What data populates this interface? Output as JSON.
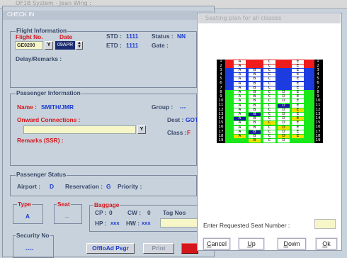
{
  "window_title": "OF1B System - Jean Wing :",
  "checkin": {
    "header": "CHECK IN",
    "flight_info": {
      "group_title": "Flight Information",
      "flight_no_label": "Flight No.",
      "date_label": "Date",
      "flight_no_value": "GE0200",
      "flight_dropdown": "Y",
      "date_value": "09APR",
      "std_label": "STD :",
      "std_value": "1111",
      "status_label": "Status :",
      "status_value": "NN",
      "etd_label": "ETD :",
      "etd_value": "1111",
      "gate_label": "Gate :",
      "delay_label": "Delay/Remarks :"
    },
    "passenger_info": {
      "group_title": "Passenger Information",
      "name_label": "Name :",
      "name_value": "SMITH/JMR",
      "group_label": "Group :",
      "group_value": "---",
      "onward_label": "Onward Connections :",
      "onward_dropdown": "Y",
      "dest_label": "Dest :",
      "dest_value": "GOT",
      "class_label": "Class :",
      "class_value": "F",
      "remarks_label": "Remarks (SSR) :"
    },
    "passenger_status": {
      "group_title": "Passenger Status",
      "airport_label": "Airport :",
      "airport_value": "D",
      "reservation_label": "Reservation :",
      "reservation_value": "G",
      "priority_label": "Priority :"
    },
    "type": {
      "group_title": "Type",
      "value": "A"
    },
    "seat": {
      "group_title": "Seat",
      "value": "_"
    },
    "baggage": {
      "group_title": "Baggage",
      "cp_label": "CP :",
      "cp_value": "0",
      "cw_label": "CW :",
      "cw_value": "0",
      "tag_label": "Tag Nos",
      "hp_label": "HP :",
      "hp_value": "xxx",
      "hw_label": "HW :",
      "hw_value": "xxx"
    },
    "security": {
      "group_title": "Security No",
      "value": "----"
    },
    "buttons": {
      "offload": "OffloAd Psgr",
      "print": "Print"
    }
  },
  "seating": {
    "title": "Seating plan for all classes",
    "request_label": "Enter Requested Seat Number :",
    "request_value": "",
    "buttons": {
      "cancel": {
        "first": "C",
        "rest": "ancel"
      },
      "up": {
        "first": "U",
        "rest": "p"
      },
      "down": {
        "first": "D",
        "rest": "own"
      },
      "ok": {
        "first": "O",
        "rest": "k"
      }
    },
    "colors": {
      "first": "#ee1c1c",
      "business": "#1c3ce0",
      "economy": "#1ae81a",
      "occupied": "#1a1aa0",
      "reserved": "#f0e000",
      "row_number": "#000000"
    },
    "rows": [
      {
        "number": "1",
        "zone": "first",
        "seats": [
          {
            "l": "A",
            "s": "free"
          },
          {
            "l": "C",
            "s": "free"
          },
          {
            "l": "E",
            "s": "free"
          }
        ]
      },
      {
        "number": "2",
        "zone": "first",
        "seats": [
          {
            "l": "A",
            "s": "free"
          },
          {
            "l": "C",
            "s": "free"
          },
          {
            "l": "E",
            "s": "free"
          }
        ]
      },
      {
        "number": "3",
        "zone": "business",
        "seats": [
          {
            "l": "A",
            "s": "free"
          },
          {
            "l": "B",
            "s": "free"
          },
          {
            "l": "C",
            "s": "free"
          },
          {
            "l": "E",
            "s": "free"
          }
        ]
      },
      {
        "number": "4",
        "zone": "business",
        "seats": [
          {
            "l": "A",
            "s": "free"
          },
          {
            "l": "B",
            "s": "free"
          },
          {
            "l": "C",
            "s": "free"
          },
          {
            "l": "E",
            "s": "free"
          }
        ]
      },
      {
        "number": "5",
        "zone": "business",
        "seats": [
          {
            "l": "A",
            "s": "free"
          },
          {
            "l": "B",
            "s": "free"
          },
          {
            "l": "C",
            "s": "free"
          },
          {
            "l": "E",
            "s": "free"
          }
        ]
      },
      {
        "number": "6",
        "zone": "business",
        "seats": [
          {
            "l": "A",
            "s": "free"
          },
          {
            "l": "B",
            "s": "free"
          },
          {
            "l": "C",
            "s": "free"
          },
          {
            "l": "E",
            "s": "free"
          }
        ]
      },
      {
        "number": "7",
        "zone": "business",
        "seats": [
          {
            "l": "A",
            "s": "free"
          },
          {
            "l": "B",
            "s": "free"
          },
          {
            "l": "C",
            "s": "free"
          },
          {
            "l": "E",
            "s": "free"
          }
        ]
      },
      {
        "number": "8",
        "zone": "economy",
        "seats": [
          {
            "l": "A",
            "s": "free"
          },
          {
            "l": "B",
            "s": "free"
          },
          {
            "l": "C",
            "s": "free"
          },
          {
            "l": "D",
            "s": "free"
          },
          {
            "l": "E",
            "s": "free"
          }
        ]
      },
      {
        "number": "9",
        "zone": "economy",
        "seats": [
          {
            "l": "A",
            "s": "free"
          },
          {
            "l": "B",
            "s": "free"
          },
          {
            "l": "C",
            "s": "free"
          },
          {
            "l": "D",
            "s": "free"
          },
          {
            "l": "E",
            "s": "free"
          }
        ]
      },
      {
        "number": "10",
        "zone": "economy",
        "seats": [
          {
            "l": "A",
            "s": "free"
          },
          {
            "l": "B",
            "s": "free"
          },
          {
            "l": "C",
            "s": "free"
          },
          {
            "l": "D",
            "s": "free"
          },
          {
            "l": "E",
            "s": "free"
          }
        ]
      },
      {
        "number": "11",
        "zone": "economy",
        "seats": [
          {
            "l": "A",
            "s": "free"
          },
          {
            "l": "B",
            "s": "free"
          },
          {
            "l": "C",
            "s": "free"
          },
          {
            "l": "D",
            "s": "occupied"
          },
          {
            "l": "E",
            "s": "free"
          }
        ]
      },
      {
        "number": "12",
        "zone": "economy",
        "seats": [
          {
            "l": "A",
            "s": "free"
          },
          {
            "l": "B",
            "s": "free"
          },
          {
            "l": "C",
            "s": "free"
          },
          {
            "l": "D",
            "s": "free"
          },
          {
            "l": "E",
            "s": "reserved"
          }
        ]
      },
      {
        "number": "13",
        "zone": "economy",
        "seats": [
          {
            "l": "A",
            "s": "free"
          },
          {
            "l": "B",
            "s": "occupied"
          },
          {
            "l": "C",
            "s": "free"
          },
          {
            "l": "D",
            "s": "free"
          },
          {
            "l": "E",
            "s": "free"
          }
        ]
      },
      {
        "number": "14",
        "zone": "economy",
        "seats": [
          {
            "l": "A",
            "s": "occupied"
          },
          {
            "l": "B",
            "s": "free"
          },
          {
            "l": "C",
            "s": "free"
          },
          {
            "l": "D",
            "s": "free"
          },
          {
            "l": "E",
            "s": "reserved"
          }
        ]
      },
      {
        "number": "15",
        "zone": "economy",
        "seats": [
          {
            "l": "A",
            "s": "free"
          },
          {
            "l": "B",
            "s": "free"
          },
          {
            "l": "C",
            "s": "reserved"
          },
          {
            "l": "D",
            "s": "free"
          },
          {
            "l": "E",
            "s": "free"
          }
        ]
      },
      {
        "number": "16",
        "zone": "economy",
        "seats": [
          {
            "l": "A",
            "s": "free"
          },
          {
            "l": "B",
            "s": "free"
          },
          {
            "l": "C",
            "s": "free"
          },
          {
            "l": "D",
            "s": "reserved"
          },
          {
            "l": "E",
            "s": "free"
          }
        ]
      },
      {
        "number": "17",
        "zone": "economy",
        "seats": [
          {
            "l": "A",
            "s": "free"
          },
          {
            "l": "B",
            "s": "occupied"
          },
          {
            "l": "C",
            "s": "free"
          },
          {
            "l": "D",
            "s": "free"
          },
          {
            "l": "E",
            "s": "free"
          }
        ]
      },
      {
        "number": "18",
        "zone": "economy",
        "seats": [
          {
            "l": "A",
            "s": "reserved"
          },
          {
            "l": "B",
            "s": "free"
          },
          {
            "l": "C",
            "s": "free"
          },
          {
            "l": "D",
            "s": "reserved"
          },
          {
            "l": "E",
            "s": "reserved"
          }
        ]
      },
      {
        "number": "19",
        "zone": "economy",
        "seats": [
          {
            "l": "B",
            "s": "reserved"
          },
          {
            "l": "C",
            "s": "free"
          },
          {
            "l": "D",
            "s": "free"
          }
        ]
      }
    ]
  }
}
